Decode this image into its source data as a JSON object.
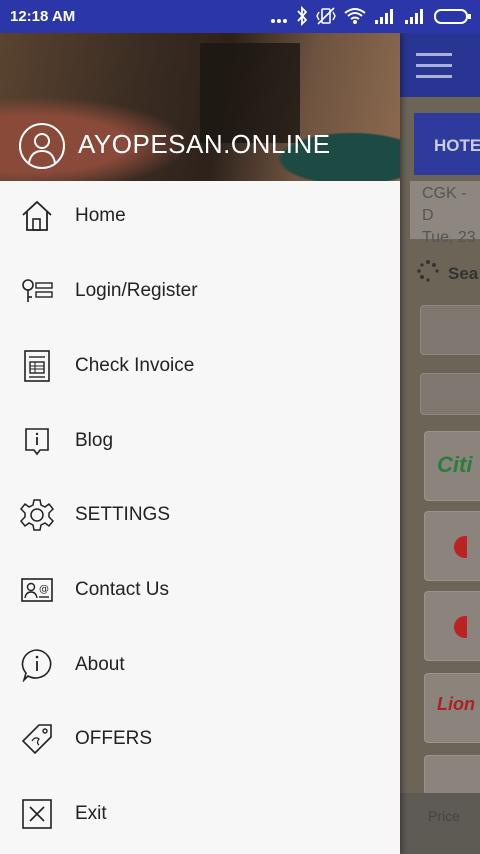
{
  "status_bar": {
    "time": "12:18 AM",
    "icons": [
      "more-dots-icon",
      "bluetooth-icon",
      "vibrate-icon",
      "wifi-icon",
      "signal-icon",
      "signal-icon",
      "battery-icon"
    ]
  },
  "drawer": {
    "brand": "AYOPESAN.ONLINE",
    "items": [
      {
        "label": "Home",
        "icon": "home-icon"
      },
      {
        "label": "Login/Register",
        "icon": "key-icon"
      },
      {
        "label": "Check Invoice",
        "icon": "invoice-icon"
      },
      {
        "label": "Blog",
        "icon": "blog-icon"
      },
      {
        "label": "SETTINGS",
        "icon": "gear-icon"
      },
      {
        "label": "Contact Us",
        "icon": "contact-card-icon"
      },
      {
        "label": "About",
        "icon": "info-icon"
      },
      {
        "label": "OFFERS",
        "icon": "tag-icon"
      },
      {
        "label": "Exit",
        "icon": "close-box-icon"
      }
    ]
  },
  "background": {
    "tab_label": "HOTE",
    "route_line1": "CGK - D",
    "route_line2": "Tue, 23",
    "search_label": "Sea",
    "airlines": [
      "Citi",
      "",
      "",
      "Lion"
    ],
    "footer_label": "Price"
  },
  "colors": {
    "status_bar": "#2b37a8",
    "app_bar": "#283593",
    "drawer_bg": "#f7f7f7"
  }
}
